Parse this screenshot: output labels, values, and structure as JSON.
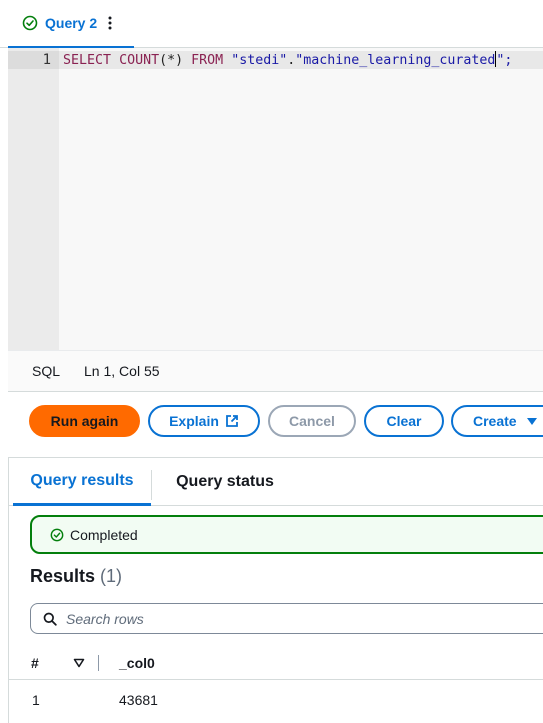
{
  "query_tab": {
    "label": "Query 2",
    "status_icon": "check-circle-icon",
    "menu_icon": "kebab-icon"
  },
  "editor": {
    "line_number": "1",
    "code_tokens": {
      "kw_select": "SELECT",
      "sp1": " ",
      "kw_count": "COUNT",
      "paren": "(*)",
      "sp2": " ",
      "kw_from": "FROM",
      "sp3": " ",
      "db_name": "\"stedi\"",
      "dot": ".",
      "table_name": "\"machine_learning_curated",
      "tail": "\";"
    }
  },
  "status_bar": {
    "language": "SQL",
    "position": "Ln 1, Col 55"
  },
  "actions": {
    "run_again": "Run again",
    "explain": "Explain",
    "cancel": "Cancel",
    "clear": "Clear",
    "create": "Create"
  },
  "results": {
    "tabs": [
      "Query results",
      "Query status"
    ],
    "alert_text": "Completed",
    "heading": "Results",
    "count": "(1)",
    "search_placeholder": "Search rows",
    "columns": {
      "hash": "#",
      "col0": "_col0"
    },
    "rows": [
      {
        "num": "1",
        "col0": "43681"
      }
    ]
  },
  "colors": {
    "accent": "#0972d3",
    "primary_button": "#ff6a00",
    "success": "#037f0c",
    "success_bg": "#f2fcf3"
  }
}
